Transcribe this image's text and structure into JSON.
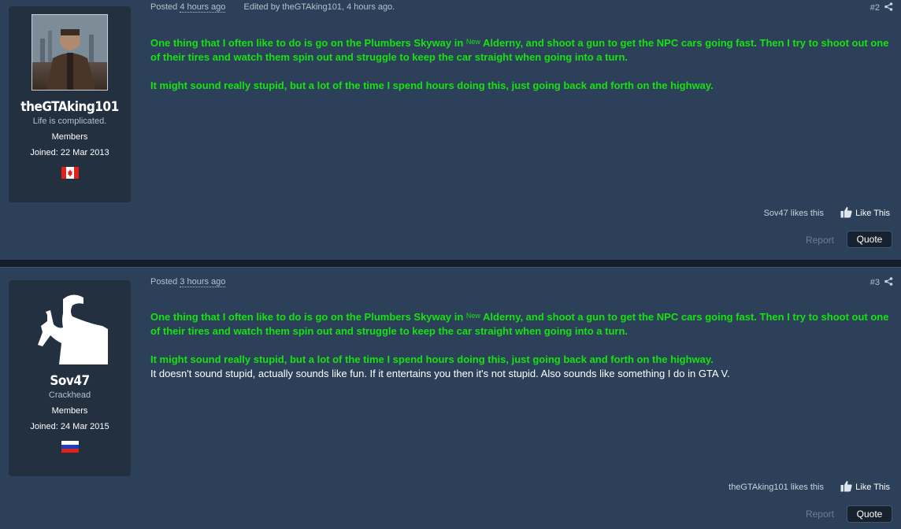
{
  "posts": [
    {
      "username": "theGTAking101",
      "user_title": "Life is complicated.",
      "group": "Members",
      "joined": "Joined: 22 Mar 2013",
      "flag": "canada-flag",
      "posted_label": "Posted",
      "posted_time": "4 hours ago",
      "edited": "Edited by theGTAking101, 4 hours ago.",
      "post_number": "#2",
      "quote_line1_before": "One thing that I often like to do is go on the Plumbers Skyway in ",
      "quote_line1_sup": "New",
      "quote_line1_after": " Alderny, and shoot a gun to get the NPC cars going fast. Then I try to shoot out one of their tires and watch them spin out and struggle to keep the car straight when going into a turn.",
      "quote_para2": "It might sound really stupid, but a lot of the time I spend hours doing this, just going back and forth on the highway.",
      "reply_text": "",
      "likes_text": "Sov47 likes this",
      "like_label": "Like This",
      "report_label": "Report",
      "quote_label": "Quote"
    },
    {
      "username": "Sov47",
      "user_title": "Crackhead",
      "group": "Members",
      "joined": "Joined: 24 Mar 2015",
      "flag": "russia-flag",
      "posted_label": "Posted",
      "posted_time": "3 hours ago",
      "edited": "",
      "post_number": "#3",
      "quote_line1_before": "One thing that I often like to do is go on the Plumbers Skyway in ",
      "quote_line1_sup": "New",
      "quote_line1_after": " Alderny, and shoot a gun to get the NPC cars going fast. Then I try to shoot out one of their tires and watch them spin out and struggle to keep the car straight when going into a turn.",
      "quote_para2": "It might sound really stupid, but a lot of the time I spend hours doing this, just going back and forth on the highway.",
      "reply_text": "It doesn't sound stupid, actually sounds like fun. If it entertains you then it's not stupid. Also sounds like something I do in GTA V.",
      "likes_text": "theGTAking101 likes this",
      "like_label": "Like This",
      "report_label": "Report",
      "quote_label": "Quote"
    }
  ],
  "colors": {
    "background": "#2c4159",
    "card": "#22303f",
    "quote_text": "#18e012"
  }
}
